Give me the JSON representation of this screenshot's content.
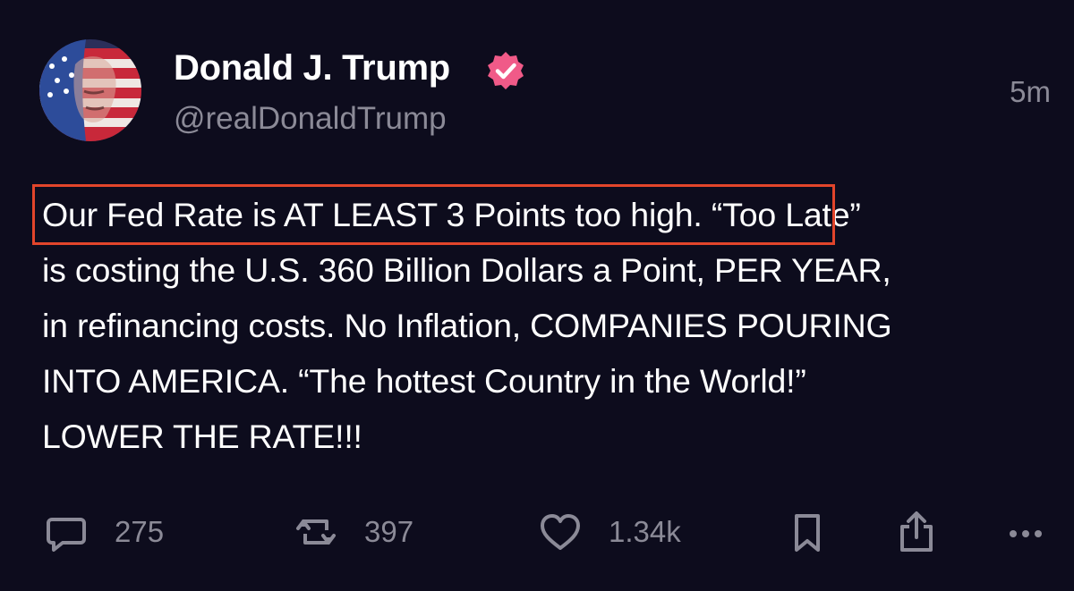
{
  "author": {
    "display_name": "Donald J. Trump",
    "handle": "@realDonaldTrump",
    "verified": true,
    "verified_badge_color": "#f05a88",
    "avatar_icon": "avatar-flag-portrait"
  },
  "timestamp": "5m",
  "post": {
    "highlighted_text": "Our Fed Rate is AT LEAST 3 Points too high.",
    "highlight_color": "#e2452b",
    "lines": [
      "“Too Late”",
      "is costing the U.S. 360 Billion Dollars a Point, PER YEAR,",
      "in refinancing costs. No Inflation, COMPANIES POURING",
      "INTO AMERICA. “The hottest Country in the World!”",
      "LOWER THE RATE!!!"
    ]
  },
  "actions": {
    "reply": {
      "icon": "reply-icon",
      "count": "275"
    },
    "repost": {
      "icon": "repost-icon",
      "count": "397"
    },
    "like": {
      "icon": "heart-icon",
      "count": "1.34k"
    },
    "bookmark": {
      "icon": "bookmark-icon"
    },
    "share": {
      "icon": "share-icon"
    },
    "more": {
      "icon": "more-icon"
    }
  },
  "colors": {
    "background": "#0d0c1d",
    "text": "#ffffff",
    "muted": "#8b8a97"
  }
}
